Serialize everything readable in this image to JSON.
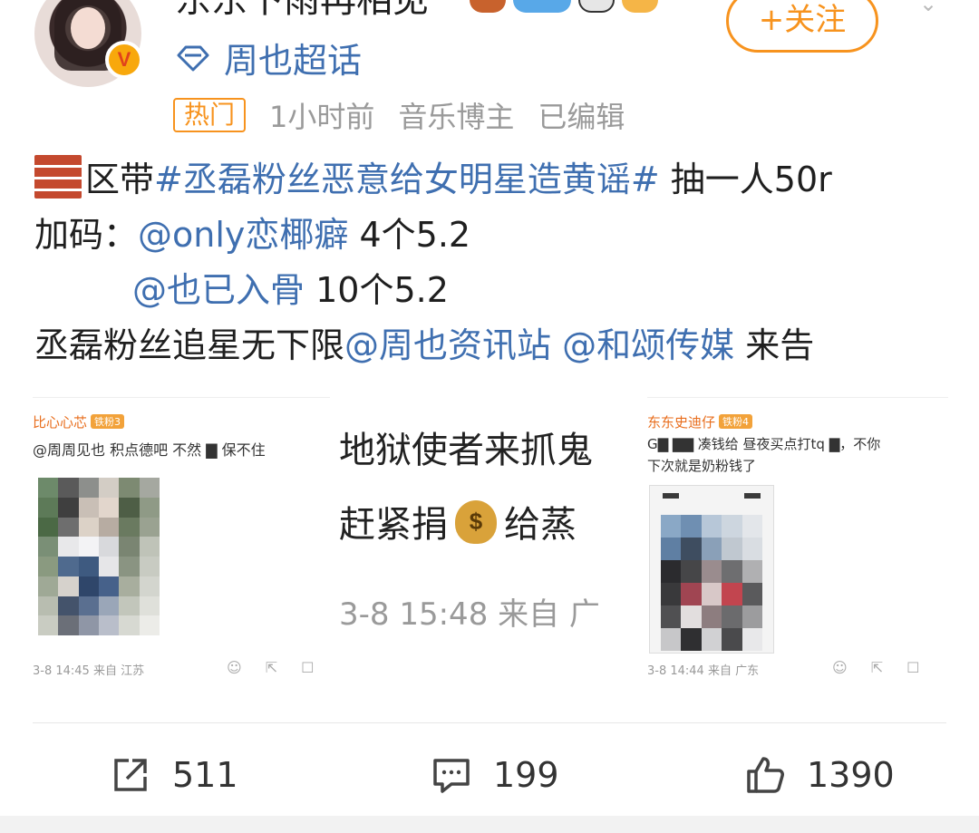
{
  "header": {
    "username": "东东下雨再相见",
    "supertopic": "周也超话",
    "follow_label": "+关注",
    "hot_tag": "热门",
    "time": "1小时前",
    "role": "音乐博主",
    "edited": "已编辑"
  },
  "post": {
    "line1_prefix": "区带",
    "line1_topic": "#丞磊粉丝恶意给女明星造黄谣#",
    "line1_suffix": " 抽一人50r",
    "line2_prefix": "加码：",
    "line2_mention": "@only恋椰癖",
    "line2_suffix": " 4个5.2",
    "line3_mention": "@也已入骨",
    "line3_suffix": " 10个5.2",
    "line4_prefix": "丞磊粉丝追星无下限",
    "line4_mention1": "@周也资讯站",
    "line4_mention2": "@和颂传媒",
    "line4_suffix": " 来告"
  },
  "images": {
    "left": {
      "user": "比心心芯",
      "level": "铁粉3",
      "comment": "@周周见也  积点德吧 不然 ▇ 保不住",
      "footer": "3-8 14:45  来自 江苏"
    },
    "middle": {
      "line1": "地狱使者来抓鬼",
      "line2_a": "赶紧捐",
      "line2_b": "给蒸",
      "date": "3-8 15:48  来自 广"
    },
    "right": {
      "user": "东东史迪仔",
      "level": "铁粉4",
      "comment1": "G▇ ▇▇ 凑钱给 昼夜买点打tq ▇，不你",
      "comment2": "下次就是奶粉钱了",
      "footer": "3-8 14:44  来自 广东"
    }
  },
  "actions": {
    "reposts": "511",
    "comments": "199",
    "likes": "1390"
  }
}
